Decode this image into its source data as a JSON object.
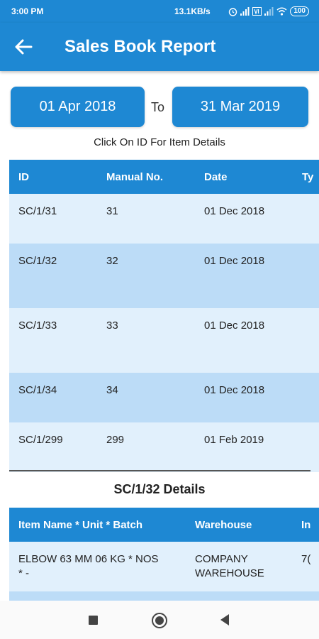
{
  "status_bar": {
    "time": "3:00 PM",
    "net_speed": "13.1KB/s",
    "battery": "100",
    "icons": [
      "alarm-icon",
      "signal-icon",
      "volte-icon",
      "signal-icon",
      "wifi-icon",
      "battery-icon"
    ]
  },
  "app_bar": {
    "title": "Sales Book Report",
    "back_icon": "arrow-left-icon"
  },
  "date_range": {
    "from": "01 Apr 2018",
    "separator": "To",
    "to": "31 Mar 2019"
  },
  "hint": "Click On ID For Item Details",
  "sales_table": {
    "columns": [
      "ID",
      "Manual No.",
      "Date",
      "Ty"
    ],
    "rows": [
      {
        "id": "SC/1/31",
        "manual_no": "31",
        "date": "01 Dec 2018"
      },
      {
        "id": "SC/1/32",
        "manual_no": "32",
        "date": "01 Dec 2018"
      },
      {
        "id": "SC/1/33",
        "manual_no": "33",
        "date": "01 Dec 2018"
      },
      {
        "id": "SC/1/34",
        "manual_no": "34",
        "date": "01 Dec 2018"
      },
      {
        "id": "SC/1/299",
        "manual_no": "299",
        "date": "01 Feb 2019"
      }
    ]
  },
  "details": {
    "title": "SC/1/32 Details",
    "columns": [
      "Item Name * Unit * Batch",
      "Warehouse",
      "In"
    ],
    "rows": [
      {
        "item_line1": "ELBOW 63 MM 06 KG * NOS",
        "item_line2": "* -",
        "warehouse_line1": "COMPANY",
        "warehouse_line2": "WAREHOUSE",
        "value": "7("
      }
    ]
  },
  "colors": {
    "primary": "#1e88d3",
    "row_light": "#e1f0fc",
    "row_dark": "#bcdcf7"
  }
}
